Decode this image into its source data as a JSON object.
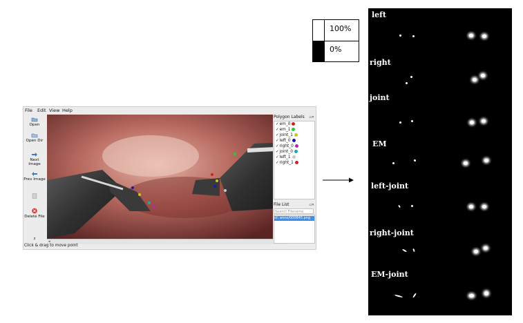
{
  "app": {
    "menu": [
      "File",
      "Edit",
      "View",
      "Help"
    ],
    "tools": [
      {
        "label": "Open",
        "icon": "open-folder-icon"
      },
      {
        "label": "Open Dir",
        "icon": "open-dir-icon"
      },
      {
        "label": "Next Image",
        "icon": "next-arrow-icon"
      },
      {
        "label": "Prev Image",
        "icon": "prev-arrow-icon"
      },
      {
        "label": "",
        "icon": "save-icon"
      },
      {
        "label": "Delete File",
        "icon": "delete-icon"
      }
    ],
    "panel_polygon_title": "Polygon Labels",
    "labels": [
      {
        "name": "em_0",
        "color": "#d42020"
      },
      {
        "name": "em_1",
        "color": "#2ec82e"
      },
      {
        "name": "joint_1",
        "color": "#c8c820"
      },
      {
        "name": "left_0",
        "color": "#1a1aa8"
      },
      {
        "name": "right_0",
        "color": "#c020c0"
      },
      {
        "name": "joint_0",
        "color": "#20a8a8"
      },
      {
        "name": "left_1",
        "color": "#c8c8c8"
      },
      {
        "name": "right_1",
        "color": "#d42020"
      }
    ],
    "checkbox_mark": "✓",
    "panel_files_title": "File List",
    "search_placeholder": "Search Filename",
    "file_item": "st: anno/000845.png",
    "status": "Click & drag to move point",
    "zoom_mark": "z"
  },
  "legend": {
    "top_text": "100%",
    "bottom_text": "0%",
    "top_color": "#ffffff",
    "bottom_color": "#000000"
  },
  "result": {
    "labels": [
      "left",
      "right",
      "joint",
      "EM",
      "left-joint",
      "right-joint",
      "EM-joint"
    ]
  }
}
